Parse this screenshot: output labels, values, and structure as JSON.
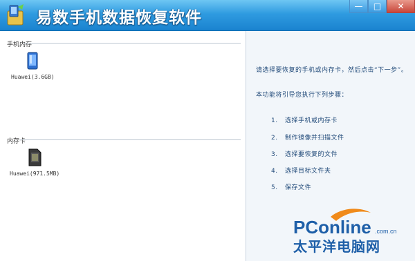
{
  "titlebar": {
    "title": "易数手机数据恢复软件",
    "minimize_icon": "minimize-icon",
    "maximize_icon": "maximize-icon",
    "close_icon": "close-icon"
  },
  "left_pane": {
    "phone_section": {
      "label": "手机内存",
      "devices": [
        {
          "name": "Huawei(3.6GB)",
          "icon": "phone-icon"
        }
      ]
    },
    "card_section": {
      "label": "内存卡",
      "devices": [
        {
          "name": "Huawei(971.5MB)",
          "icon": "sd-card-icon"
        }
      ]
    }
  },
  "right_pane": {
    "intro_line1": "请选择要恢复的手机或内存卡，然后点击“下一步”。",
    "intro_line2": "本功能将引导您执行下列步骤：",
    "steps": [
      {
        "num": "1.",
        "text": "选择手机或内存卡"
      },
      {
        "num": "2.",
        "text": "制作镜像并扫描文件"
      },
      {
        "num": "3.",
        "text": "选择要恢复的文件"
      },
      {
        "num": "4.",
        "text": "选择目标文件夹"
      },
      {
        "num": "5.",
        "text": "保存文件"
      }
    ]
  },
  "watermark": {
    "brand": "PConline",
    "domain": ".com.cn",
    "subtitle": "太平洋电脑网",
    "colors": {
      "brand": "#1e5fa8",
      "swoosh": "#f08a1a"
    }
  }
}
